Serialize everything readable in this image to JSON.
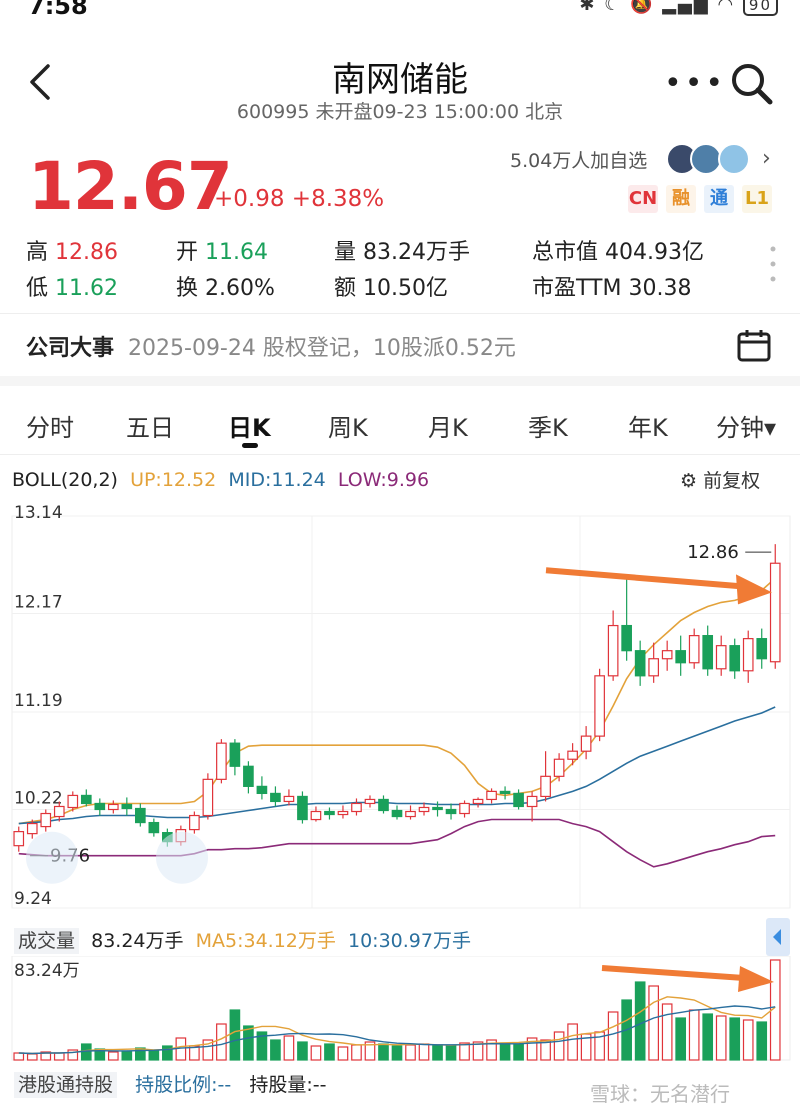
{
  "status": {
    "time": "7:58",
    "battery": "90"
  },
  "header": {
    "title": "南网储能",
    "subtitle": "600995 未开盘09-23 15:00:00 北京"
  },
  "quote": {
    "price": "12.67",
    "change": "+0.98",
    "change_pct": "+8.38%",
    "watchers": "5.04万人加自选",
    "badges": [
      {
        "label": "CN",
        "color": "#e0343a"
      },
      {
        "label": "融",
        "color": "#e8912b"
      },
      {
        "label": "通",
        "color": "#2f7fd8"
      },
      {
        "label": "L1",
        "color": "#d9a31a"
      }
    ],
    "high_label": "高",
    "high": "12.86",
    "open_label": "开",
    "open": "11.64",
    "volume_label": "量",
    "volume": "83.24万手",
    "mktcap_label": "总市值",
    "mktcap": "404.93亿",
    "low_label": "低",
    "low": "11.62",
    "turnover_label": "换",
    "turnover": "2.60%",
    "amount_label": "额",
    "amount": "10.50亿",
    "pe_label": "市盈TTM",
    "pe": "30.38"
  },
  "event": {
    "title": "公司大事",
    "text": "2025-09-24 股权登记，10股派0.52元"
  },
  "tabs": [
    "分时",
    "五日",
    "日K",
    "周K",
    "月K",
    "季K",
    "年K",
    "分钟▾"
  ],
  "boll": {
    "name": "BOLL(20,2)",
    "up": "UP:12.52",
    "mid": "MID:11.24",
    "low": "LOW:9.96",
    "fq": "前复权"
  },
  "volume_bar": {
    "name": "成交量",
    "vol": "83.24万手",
    "ma5": "MA5:34.12万手",
    "ma10": "10:30.97万手",
    "axis_top": "83.24万"
  },
  "hk": {
    "name": "港股通持股",
    "ratio": "持股比例:--",
    "amount": "持股量:--"
  },
  "watermark": "雪球：无名潜行",
  "colors": {
    "up": "#e0343a",
    "down": "#1aa05a",
    "boll_up": "#e3a23a",
    "boll_mid": "#2a6f9e",
    "boll_low": "#8b2a78",
    "arrow": "#f07b35"
  },
  "chart_data": {
    "type": "candlestick",
    "ylim": [
      9.24,
      13.14
    ],
    "y_ticks": [
      "13.14",
      "12.17",
      "11.19",
      "10.22",
      "9.24"
    ],
    "high_marker": "12.86",
    "low_marker": "9.76",
    "candles": [
      [
        9.86,
        10.0,
        10.05,
        9.8
      ],
      [
        9.98,
        10.08,
        10.12,
        9.93
      ],
      [
        10.05,
        10.18,
        10.22,
        10.0
      ],
      [
        10.15,
        10.25,
        10.3,
        10.1
      ],
      [
        10.24,
        10.36,
        10.4,
        10.2
      ],
      [
        10.36,
        10.28,
        10.42,
        10.25
      ],
      [
        10.28,
        10.22,
        10.33,
        10.16
      ],
      [
        10.22,
        10.27,
        10.31,
        10.18
      ],
      [
        10.27,
        10.23,
        10.34,
        10.16
      ],
      [
        10.23,
        10.09,
        10.28,
        10.05
      ],
      [
        10.09,
        9.99,
        10.13,
        9.95
      ],
      [
        9.99,
        9.9,
        10.03,
        9.85
      ],
      [
        9.9,
        10.02,
        10.06,
        9.86
      ],
      [
        10.02,
        10.16,
        10.2,
        9.98
      ],
      [
        10.16,
        10.52,
        10.58,
        10.12
      ],
      [
        10.52,
        10.88,
        10.92,
        10.48
      ],
      [
        10.88,
        10.65,
        10.92,
        10.56
      ],
      [
        10.65,
        10.45,
        10.7,
        10.38
      ],
      [
        10.45,
        10.38,
        10.55,
        10.32
      ],
      [
        10.38,
        10.3,
        10.45,
        10.25
      ],
      [
        10.3,
        10.35,
        10.42,
        10.26
      ],
      [
        10.35,
        10.12,
        10.4,
        10.08
      ],
      [
        10.12,
        10.2,
        10.25,
        10.1
      ],
      [
        10.2,
        10.17,
        10.24,
        10.12
      ],
      [
        10.17,
        10.2,
        10.26,
        10.13
      ],
      [
        10.2,
        10.28,
        10.33,
        10.16
      ],
      [
        10.28,
        10.32,
        10.36,
        10.24
      ],
      [
        10.32,
        10.21,
        10.36,
        10.18
      ],
      [
        10.21,
        10.15,
        10.26,
        10.12
      ],
      [
        10.15,
        10.2,
        10.26,
        10.12
      ],
      [
        10.2,
        10.24,
        10.29,
        10.16
      ],
      [
        10.24,
        10.22,
        10.3,
        10.15
      ],
      [
        10.22,
        10.18,
        10.28,
        10.12
      ],
      [
        10.18,
        10.28,
        10.31,
        10.14
      ],
      [
        10.28,
        10.32,
        10.34,
        10.24
      ],
      [
        10.32,
        10.4,
        10.43,
        10.28
      ],
      [
        10.4,
        10.38,
        10.45,
        10.32
      ],
      [
        10.38,
        10.25,
        10.42,
        10.22
      ],
      [
        10.25,
        10.35,
        10.4,
        10.1
      ],
      [
        10.35,
        10.55,
        10.8,
        10.3
      ],
      [
        10.55,
        10.72,
        10.78,
        10.5
      ],
      [
        10.72,
        10.8,
        10.88,
        10.66
      ],
      [
        10.8,
        10.95,
        11.05,
        10.72
      ],
      [
        10.95,
        11.55,
        11.62,
        10.9
      ],
      [
        11.55,
        12.05,
        12.2,
        11.5
      ],
      [
        12.05,
        11.8,
        12.52,
        11.7
      ],
      [
        11.8,
        11.55,
        11.9,
        11.45
      ],
      [
        11.55,
        11.72,
        11.88,
        11.48
      ],
      [
        11.72,
        11.8,
        11.9,
        11.6
      ],
      [
        11.8,
        11.68,
        11.95,
        11.55
      ],
      [
        11.68,
        11.95,
        12.02,
        11.62
      ],
      [
        11.95,
        11.62,
        12.05,
        11.55
      ],
      [
        11.62,
        11.85,
        11.95,
        11.55
      ],
      [
        11.85,
        11.6,
        11.92,
        11.52
      ],
      [
        11.6,
        11.92,
        12.0,
        11.48
      ],
      [
        11.92,
        11.72,
        12.02,
        11.62
      ],
      [
        11.69,
        12.67,
        12.86,
        11.62
      ]
    ],
    "boll_up": [
      10.08,
      10.1,
      10.12,
      10.16,
      10.22,
      10.26,
      10.28,
      10.28,
      10.28,
      10.28,
      10.28,
      10.28,
      10.28,
      10.3,
      10.4,
      10.6,
      10.78,
      10.85,
      10.86,
      10.86,
      10.86,
      10.86,
      10.86,
      10.86,
      10.86,
      10.86,
      10.86,
      10.86,
      10.86,
      10.86,
      10.86,
      10.84,
      10.78,
      10.66,
      10.48,
      10.38,
      10.36,
      10.38,
      10.4,
      10.45,
      10.55,
      10.68,
      10.82,
      11.0,
      11.25,
      11.52,
      11.72,
      11.86,
      11.98,
      12.1,
      12.18,
      12.24,
      12.28,
      12.3,
      12.34,
      12.4,
      12.52
    ],
    "boll_mid": [
      10.08,
      10.09,
      10.1,
      10.12,
      10.13,
      10.15,
      10.16,
      10.16,
      10.16,
      10.16,
      10.15,
      10.14,
      10.14,
      10.14,
      10.15,
      10.17,
      10.19,
      10.21,
      10.23,
      10.25,
      10.27,
      10.27,
      10.28,
      10.28,
      10.28,
      10.29,
      10.29,
      10.29,
      10.28,
      10.28,
      10.28,
      10.27,
      10.27,
      10.27,
      10.27,
      10.27,
      10.28,
      10.28,
      10.29,
      10.32,
      10.36,
      10.4,
      10.45,
      10.52,
      10.6,
      10.68,
      10.75,
      10.8,
      10.85,
      10.9,
      10.95,
      11.0,
      11.05,
      11.1,
      11.14,
      11.18,
      11.24
    ],
    "boll_low": [
      9.78,
      9.77,
      9.76,
      9.76,
      9.76,
      9.76,
      9.76,
      9.76,
      9.76,
      9.76,
      9.76,
      9.76,
      9.76,
      9.78,
      9.82,
      9.82,
      9.83,
      9.83,
      9.84,
      9.86,
      9.88,
      9.88,
      9.88,
      9.88,
      9.88,
      9.88,
      9.88,
      9.88,
      9.88,
      9.88,
      9.9,
      9.92,
      9.98,
      10.05,
      10.1,
      10.12,
      10.12,
      10.12,
      10.12,
      10.12,
      10.12,
      10.08,
      10.05,
      10.0,
      9.9,
      9.8,
      9.72,
      9.65,
      9.68,
      9.72,
      9.76,
      9.8,
      9.83,
      9.87,
      9.9,
      9.95,
      9.96
    ],
    "volumes": [
      7,
      6,
      8,
      7,
      10,
      16,
      11,
      8,
      9,
      12,
      10,
      14,
      22,
      14,
      20,
      36,
      50,
      34,
      28,
      20,
      24,
      18,
      14,
      16,
      13,
      15,
      18,
      16,
      14,
      15,
      16,
      15,
      14,
      17,
      18,
      20,
      17,
      16,
      22,
      20,
      28,
      36,
      26,
      28,
      48,
      60,
      78,
      74,
      56,
      42,
      50,
      46,
      44,
      42,
      40,
      38,
      100
    ]
  }
}
